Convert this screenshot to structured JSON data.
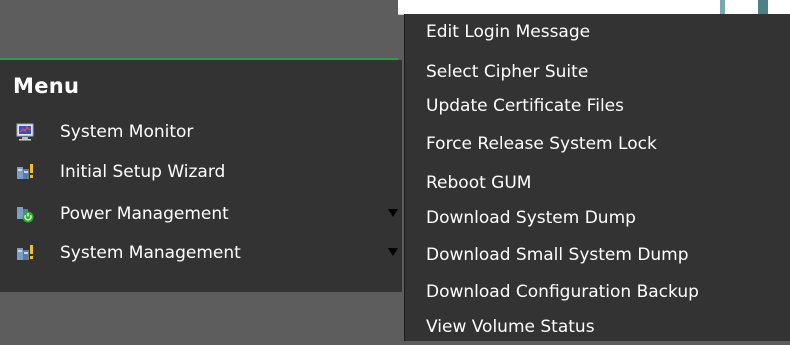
{
  "menu": {
    "title": "Menu",
    "items": [
      {
        "label": "System Monitor",
        "icon": "monitor-icon",
        "has_submenu": false
      },
      {
        "label": "Initial Setup Wizard",
        "icon": "wizard-icon",
        "has_submenu": false
      },
      {
        "label": "Power Management",
        "icon": "power-icon",
        "has_submenu": true
      },
      {
        "label": "System Management",
        "icon": "system-icon",
        "has_submenu": true
      }
    ]
  },
  "dropdown": {
    "items": [
      "Edit Login Message",
      "Select Cipher Suite",
      "Update Certificate Files",
      "Force Release System Lock",
      "Reboot GUM",
      "Download System Dump",
      "Download Small System Dump",
      "Download Configuration Backup",
      "View Volume Status"
    ]
  },
  "colors": {
    "background": "#5d5d5d",
    "panel": "#333333",
    "accent_rule": "#2f9d4b",
    "text": "#ffffff"
  }
}
